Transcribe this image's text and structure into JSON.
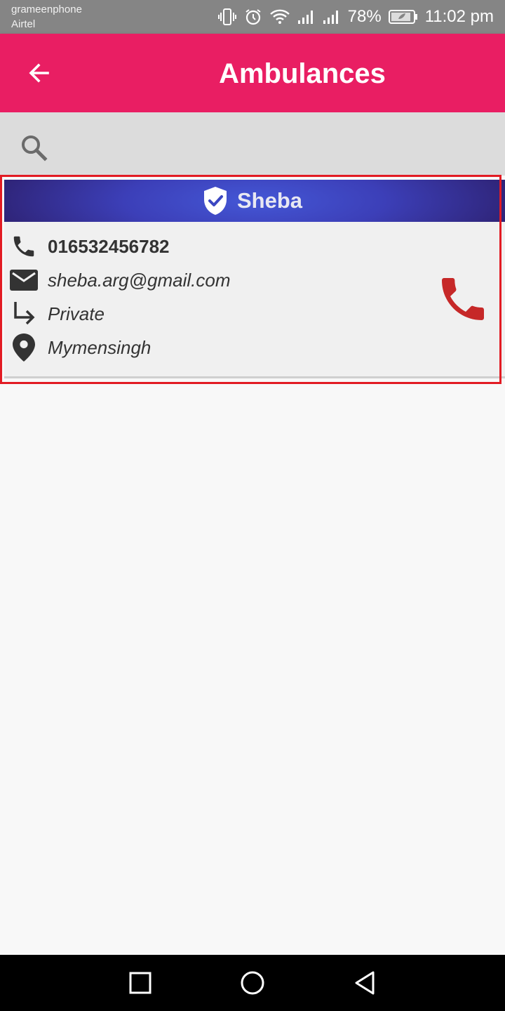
{
  "status_bar": {
    "carrier_1": "grameenphone",
    "carrier_2": "Airtel",
    "battery": "78%",
    "time": "11:02 pm",
    "icons": [
      "vibrate-icon",
      "alarm-icon",
      "wifi-icon",
      "signal-icon",
      "signal-icon",
      "battery-icon"
    ]
  },
  "app_bar": {
    "title": "Ambulances",
    "back_icon": "arrow-back-icon",
    "color": "#e91e63"
  },
  "search": {
    "icon": "search-icon"
  },
  "ambulance": {
    "name": "Sheba",
    "badge_icon": "verified-shield-icon",
    "phone": "016532456782",
    "email": "sheba.arg@gmail.com",
    "type": "Private",
    "location": "Mymensingh",
    "call_icon": "phone-icon",
    "call_color": "#c62828"
  },
  "nav_bar": {
    "buttons": [
      "recents-square-icon",
      "home-circle-icon",
      "back-triangle-icon"
    ]
  }
}
